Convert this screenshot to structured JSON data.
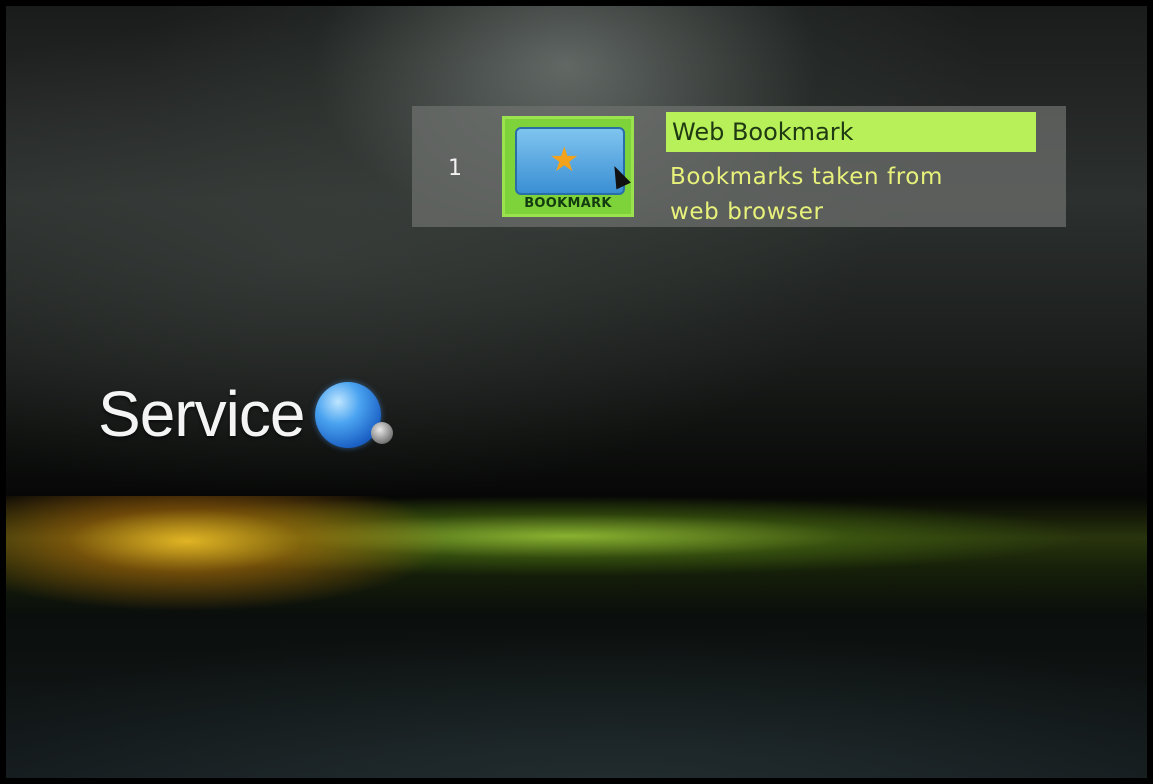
{
  "service_menu": {
    "section_title": "Service",
    "section_icon": "globe-icon",
    "items": [
      {
        "number": "1",
        "thumbnail_label": "BOOKMARK",
        "thumbnail_icon": "bookmark-star-icon",
        "title": "Web Bookmark",
        "description_line1": "Bookmarks taken from",
        "description_line2": "web browser",
        "selected": true
      }
    ]
  },
  "colors": {
    "highlight": "#b8f05a",
    "description_text": "#e8f27a",
    "item_background": "#6e706e"
  }
}
